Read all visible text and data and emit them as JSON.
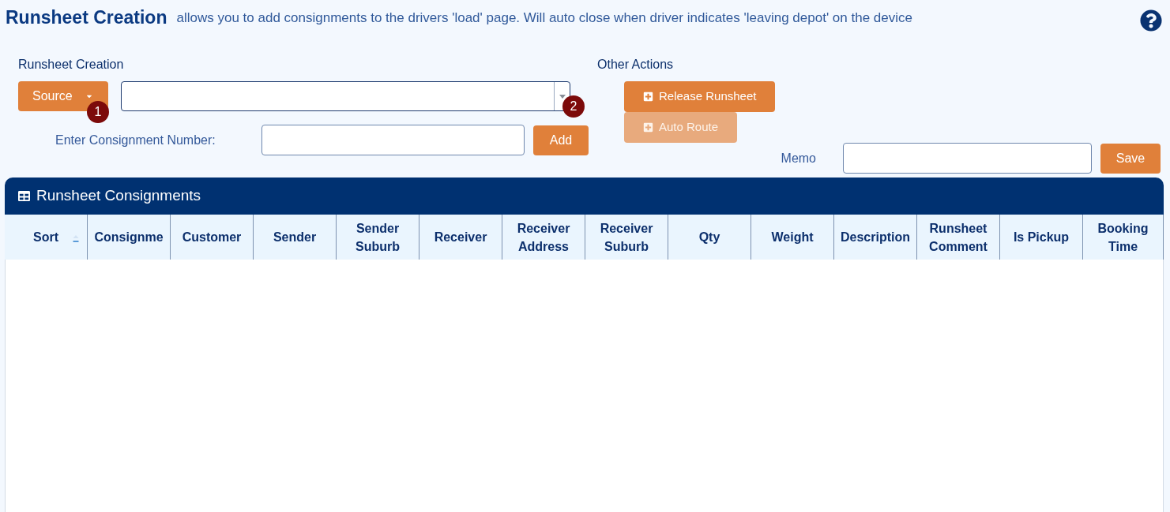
{
  "header": {
    "title": "Runsheet Creation",
    "description": "allows you to add consignments to the drivers 'load' page. Will auto close when driver indicates 'leaving depot' on the device"
  },
  "runsheet_creation": {
    "heading": "Runsheet Creation",
    "source_button": {
      "label": "Source",
      "step": "1"
    },
    "source_select": {
      "step": "2"
    },
    "consignment_label": "Enter Consignment Number:",
    "add_button": "Add"
  },
  "other_actions": {
    "heading": "Other Actions",
    "buttons": [
      {
        "label": "Release Runsheet",
        "disabled": false
      },
      {
        "label": "Auto Route",
        "disabled": true
      }
    ]
  },
  "memo": {
    "label": "Memo",
    "save_button": "Save"
  },
  "consignments_panel": {
    "title": "Runsheet Consignments",
    "columns": [
      {
        "label": "Sort",
        "kind": "sortable"
      },
      {
        "label": "Consignme",
        "kind": "plain"
      },
      {
        "label": "Customer",
        "kind": "plain"
      },
      {
        "label": "Sender",
        "kind": "plain"
      },
      {
        "label": "Sender Suburb",
        "kind": "plain"
      },
      {
        "label": "Receiver",
        "kind": "plain"
      },
      {
        "label": "Receiver Address",
        "kind": "plain"
      },
      {
        "label": "Receiver Suburb",
        "kind": "plain"
      },
      {
        "label": "Qty",
        "kind": "plain"
      },
      {
        "label": "Weight",
        "kind": "plain"
      },
      {
        "label": "Description",
        "kind": "plain"
      },
      {
        "label": "Runsheet Comment",
        "kind": "plain"
      },
      {
        "label": "Is Pickup",
        "kind": "plain"
      },
      {
        "label": "Booking Time",
        "kind": "plain"
      }
    ]
  }
}
